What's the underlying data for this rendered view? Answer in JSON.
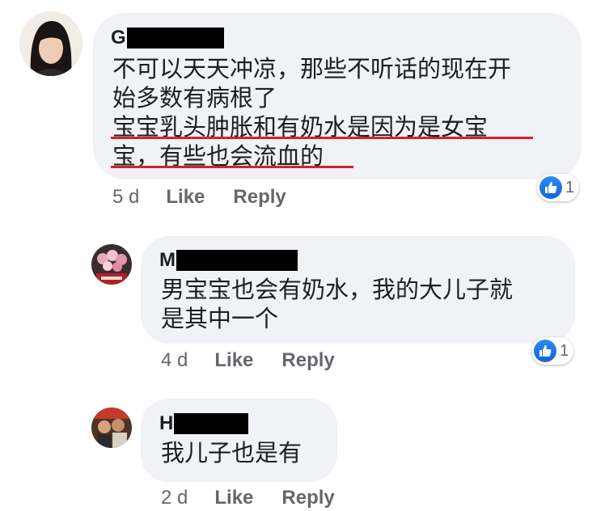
{
  "comments": [
    {
      "author_initial": "G",
      "lines": [
        "不可以天天冲凉，那些不听话的现在开",
        "始多数有病根了",
        "宝宝乳头肿胀和有奶水是因为是女宝",
        "宝，有些也会流血的"
      ],
      "time": "5 d",
      "like_label": "Like",
      "reply_label": "Reply",
      "reaction_count": "1"
    },
    {
      "author_initial": "M",
      "lines": [
        "男宝宝也会有奶水，我的大儿子就",
        "是其中一个"
      ],
      "time": "4 d",
      "like_label": "Like",
      "reply_label": "Reply",
      "reaction_count": "1"
    },
    {
      "author_initial": "H",
      "lines": [
        "我儿子也是有"
      ],
      "time": "2 d",
      "like_label": "Like",
      "reply_label": "Reply"
    }
  ],
  "colors": {
    "bubble": "#f0f2f5",
    "like_blue": "#1877f2",
    "underline_red": "#d32033",
    "meta_gray": "#65676b"
  },
  "icons": [
    "like-thumb-icon"
  ]
}
